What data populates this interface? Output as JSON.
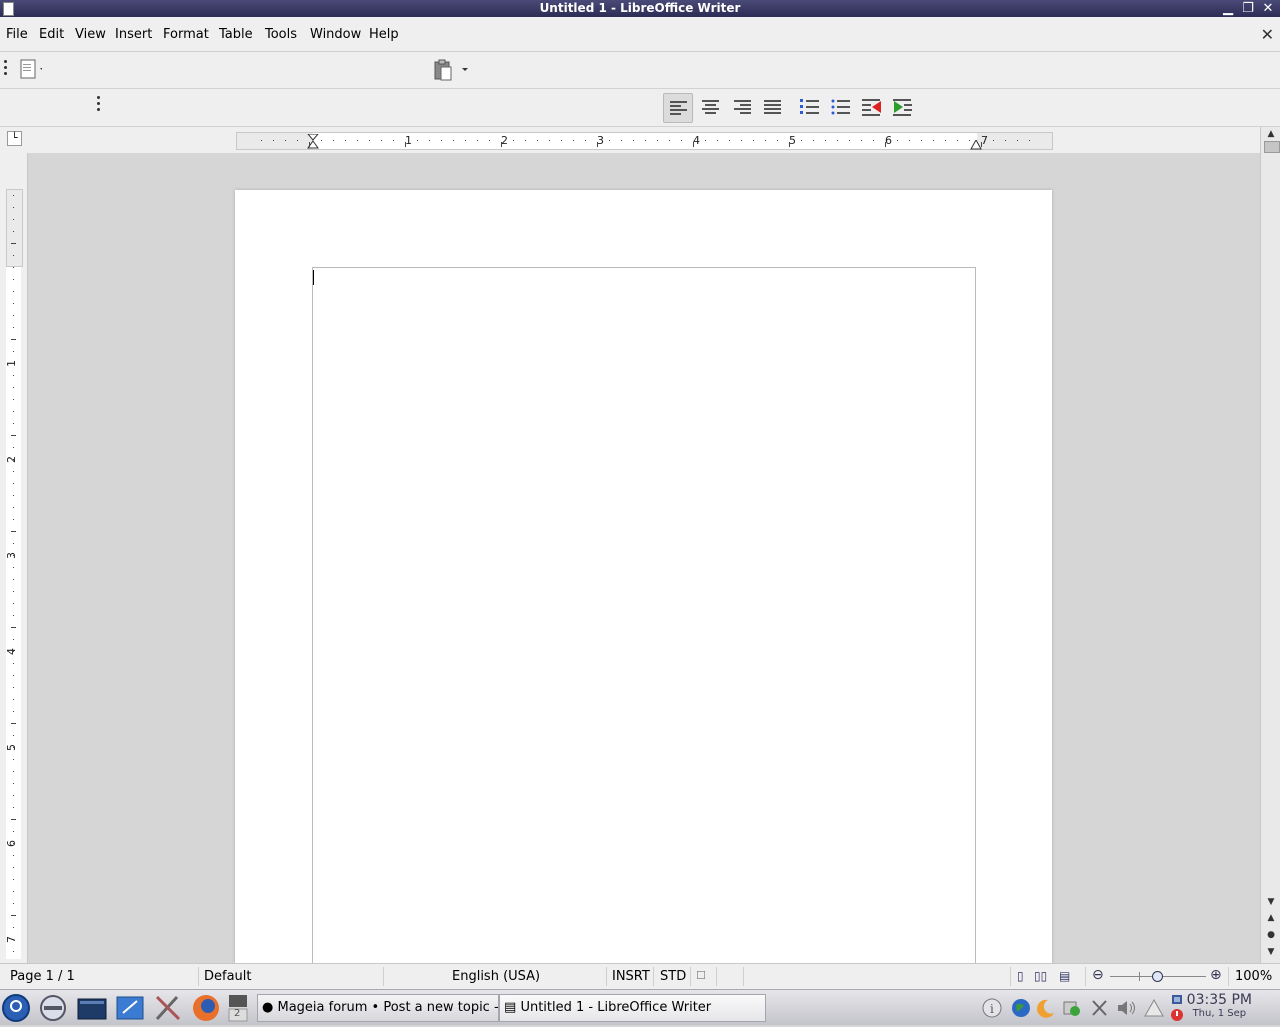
{
  "window": {
    "title": "Untitled 1 - LibreOffice Writer"
  },
  "menu": [
    "File",
    "Edit",
    "View",
    "Insert",
    "Format",
    "Table",
    "Tools",
    "Window",
    "Help"
  ],
  "ruler": {
    "horizontal_numbers": [
      "1",
      "2",
      "3",
      "4",
      "5",
      "6",
      "7"
    ],
    "vertical_numbers": [
      "1",
      "2",
      "3",
      "4",
      "5",
      "6",
      "7"
    ]
  },
  "statusbar": {
    "page": "Page 1 / 1",
    "page_style": "Default",
    "language": "English (USA)",
    "insert_mode": "INSRT",
    "selection_mode": "STD",
    "zoom": "100%"
  },
  "taskbar": {
    "tasks": [
      "Mageia forum • Post a new topic -",
      "Untitled 1 - LibreOffice Writer"
    ],
    "workspace": "2",
    "clock_time": "03:35 PM",
    "clock_date": "Thu, 1 Sep"
  },
  "icons": {
    "menu_start": "mageia-menu-icon",
    "browser": "firefox-icon",
    "tools": "tools-icon",
    "terminal": "terminal-icon"
  }
}
